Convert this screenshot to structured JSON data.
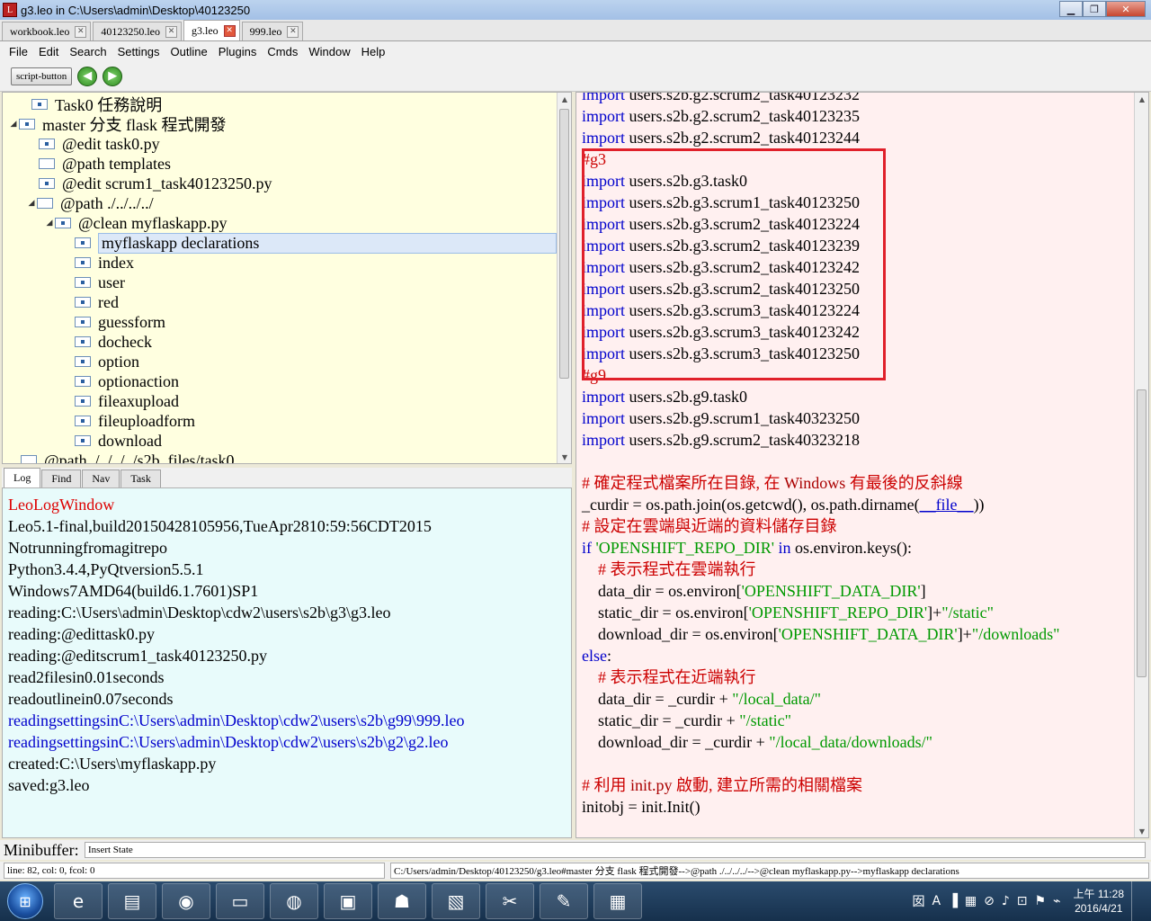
{
  "window": {
    "title": "g3.leo in C:\\Users\\admin\\Desktop\\40123250"
  },
  "tabs": [
    {
      "label": "workbook.leo"
    },
    {
      "label": "40123250.leo"
    },
    {
      "label": "g3.leo"
    },
    {
      "label": "999.leo"
    }
  ],
  "menu": [
    "File",
    "Edit",
    "Search",
    "Settings",
    "Outline",
    "Plugins",
    "Cmds",
    "Window",
    "Help"
  ],
  "toolbar": {
    "script_button": "script-button"
  },
  "outline": {
    "nodes": [
      {
        "label": "Task0 任務說明"
      },
      {
        "label": "master 分支 flask 程式開發"
      },
      {
        "label": "@edit task0.py"
      },
      {
        "label": "@path templates"
      },
      {
        "label": "@edit scrum1_task40123250.py"
      },
      {
        "label": "@path ./../../../"
      },
      {
        "label": "@clean myflaskapp.py"
      },
      {
        "label": "myflaskapp declarations"
      },
      {
        "label": "index"
      },
      {
        "label": "user"
      },
      {
        "label": "red"
      },
      {
        "label": "guessform"
      },
      {
        "label": "docheck"
      },
      {
        "label": "option"
      },
      {
        "label": "optionaction"
      },
      {
        "label": "fileaxupload"
      },
      {
        "label": "fileuploadform"
      },
      {
        "label": "download"
      },
      {
        "label": "@path ./../../../s2b_files/task0"
      }
    ]
  },
  "log_tabs": [
    "Log",
    "Find",
    "Nav",
    "Task"
  ],
  "log_lines": [
    "LeoLogWindow",
    "Leo5.1-final,build20150428105956,TueApr2810:59:56CDT2015",
    "Notrunningfromagitrepo",
    "Python3.4.4,PyQtversion5.5.1",
    "Windows7AMD64(build6.1.7601)SP1",
    "reading:C:\\Users\\admin\\Desktop\\cdw2\\users\\s2b\\g3\\g3.leo",
    "reading:@edittask0.py",
    "reading:@editscrum1_task40123250.py",
    "read2filesin0.01seconds",
    "readoutlinein0.07seconds",
    "readingsettingsinC:\\Users\\admin\\Desktop\\cdw2\\users\\s2b\\g99\\999.leo",
    "readingsettingsinC:\\Users\\admin\\Desktop\\cdw2\\users\\s2b\\g2\\g2.leo",
    "created:C:\\Users\\myflaskapp.py",
    "saved:g3.leo"
  ],
  "code": {
    "kw_import": "import",
    "kw_if": "if",
    "kw_in": "in",
    "kw_else": "else",
    "l1": " users.s2b.g2.scrum2_task40123232",
    "l2": " users.s2b.g2.scrum2_task40123235",
    "l3": " users.s2b.g2.scrum2_task40123244",
    "g3": "#g3",
    "g3_1": " users.s2b.g3.task0",
    "g3_2": " users.s2b.g3.scrum1_task40123250",
    "g3_3": " users.s2b.g3.scrum2_task40123224",
    "g3_4": " users.s2b.g3.scrum2_task40123239",
    "g3_5": " users.s2b.g3.scrum2_task40123242",
    "g3_6": " users.s2b.g3.scrum2_task40123250",
    "g3_7": " users.s2b.g3.scrum3_task40123224",
    "g3_8": " users.s2b.g3.scrum3_task40123242",
    "g3_9": " users.s2b.g3.scrum3_task40123250",
    "g9": "#g9",
    "g9_1": " users.s2b.g9.task0",
    "g9_2": " users.s2b.g9.scrum1_task40323250",
    "g9_3": " users.s2b.g9.scrum2_task40323218",
    "c1a": "# 確定程式檔案所在目錄, 在 ",
    "c1b": "Windows",
    "c1c": " 有最後的反斜線",
    "curdir_a": "_curdir = os.path.join(os.getcwd(), os.path.dirname(",
    "curdir_b": "__file__",
    "curdir_c": "))",
    "c2": "# 設定在雲端與近端的資料儲存目錄",
    "if_s": "'OPENSHIFT_REPO_DIR'",
    "if_rest": " os.environ.keys():",
    "c3": "    # 表示程式在雲端執行",
    "dd_a": "    data_dir = os.environ[",
    "dd_s": "'OPENSHIFT_DATA_DIR'",
    "dd_c": "]",
    "sd_a": "    static_dir = os.environ[",
    "sd_s": "'OPENSHIFT_REPO_DIR'",
    "sd_c": "]+",
    "sd_s2": "\"/static\"",
    "dl_a": "    download_dir = os.environ[",
    "dl_s": "'OPENSHIFT_DATA_DIR'",
    "dl_c": "]+",
    "dl_s2": "\"/downloads\"",
    "else_c": ":",
    "c4": "    # 表示程式在近端執行",
    "ld_a": "    data_dir = _curdir + ",
    "ld_s": "\"/local_data/\"",
    "ls_a": "    static_dir = _curdir + ",
    "ls_s": "\"/static\"",
    "ldl_a": "    download_dir = _curdir + ",
    "ldl_s": "\"/local_data/downloads/\"",
    "c5a": "# 利用 ",
    "c5b": "init.py",
    "c5c": " 啟動, 建立所需的相關檔案",
    "init": "initobj = init.Init()"
  },
  "minibuffer": {
    "label": "Minibuffer:",
    "value": "Insert State"
  },
  "status": {
    "position": "line: 82, col: 0, fcol: 0",
    "path": "C:/Users/admin/Desktop/40123250/g3.leo#master 分支 flask 程式開發-->@path ./../../../-->@clean myflaskapp.py-->myflaskapp declarations"
  },
  "taskbar": {
    "clock_time": "上午 11:28",
    "clock_date": "2016/4/21"
  },
  "colors": {
    "highlight_box": "#e0202a",
    "keyword": "#0000cc",
    "comment": "#cc0000",
    "string": "#009900",
    "outline_bg": "#ffffe0",
    "log_bg": "#e8fbfb",
    "body_bg": "#fff0f0"
  }
}
